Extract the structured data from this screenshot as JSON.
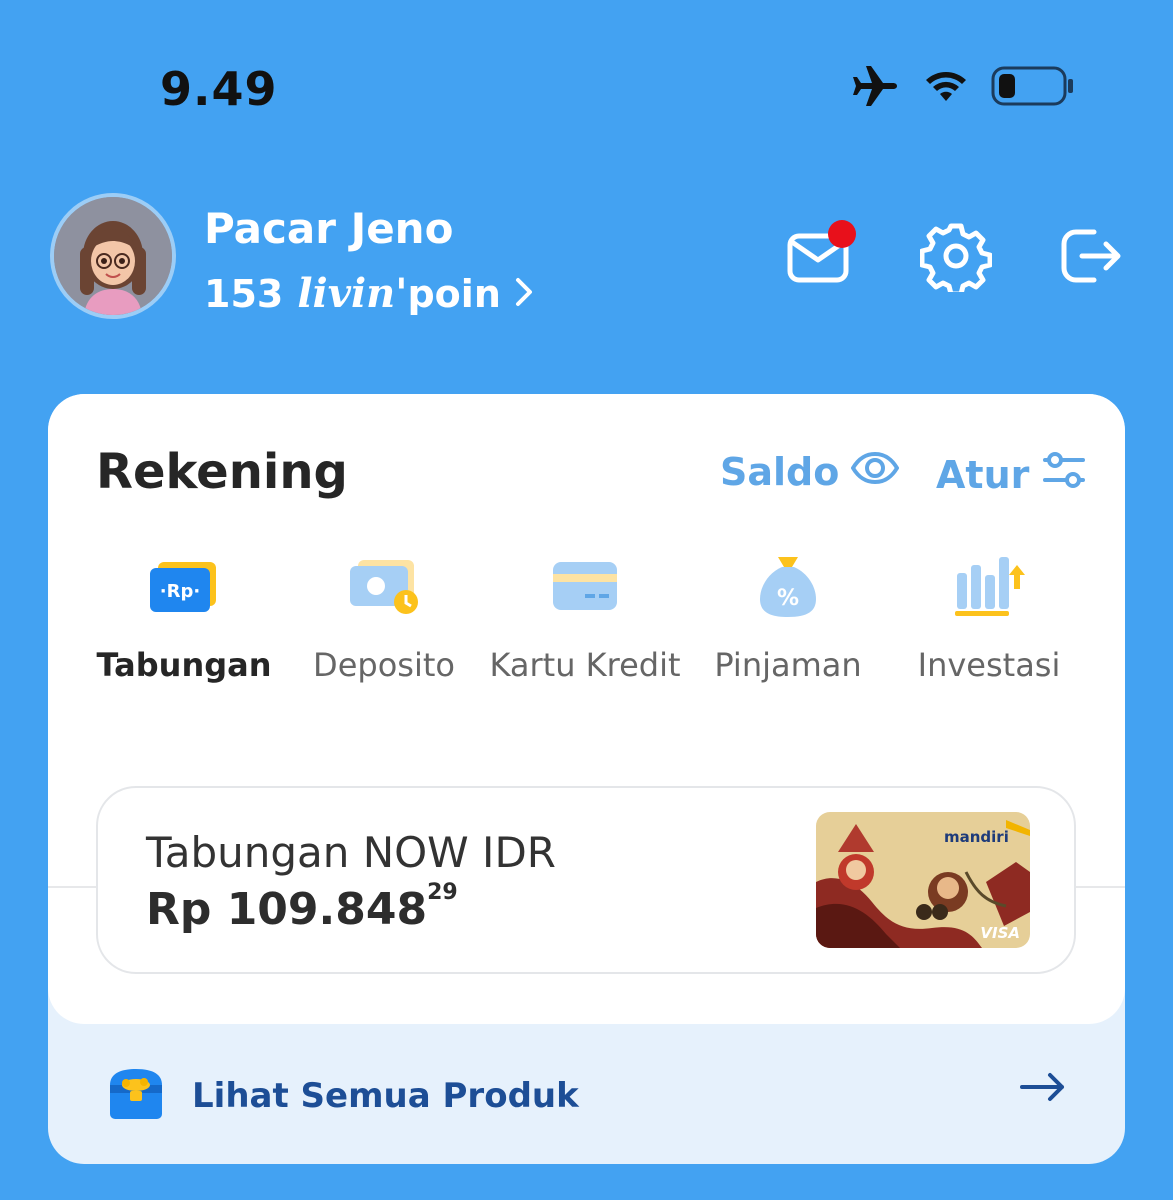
{
  "status_bar": {
    "time": "9.49",
    "icons": [
      "airplane-icon",
      "wifi-icon",
      "battery-icon"
    ]
  },
  "header": {
    "user_name": "Pacar Jeno",
    "points": "153",
    "points_brand": "livin'",
    "points_suffix": "poin",
    "actions": [
      "mail-icon",
      "gear-icon",
      "logout-icon"
    ]
  },
  "card": {
    "title": "Rekening",
    "saldo_label": "Saldo",
    "atur_label": "Atur",
    "tabs": [
      {
        "label": "Tabungan",
        "icon": "rp-wallet-icon",
        "active": true
      },
      {
        "label": "Deposito",
        "icon": "deposit-icon",
        "active": false
      },
      {
        "label": "Kartu Kredit",
        "icon": "credit-card-icon",
        "active": false
      },
      {
        "label": "Pinjaman",
        "icon": "money-bag-icon",
        "active": false
      },
      {
        "label": "Investasi",
        "icon": "investment-chart-icon",
        "active": false
      }
    ],
    "account": {
      "name": "Tabungan NOW IDR",
      "balance": "Rp 109.848",
      "balance_cents": "29",
      "card_brand": "mandiri",
      "card_network": "VISA"
    },
    "all_products_label": "Lihat Semua Produk"
  },
  "colors": {
    "background": "#43a2f2",
    "accent": "#5fa6e6",
    "tab_indicator": "#fcc21c",
    "link": "#1d4e96"
  }
}
